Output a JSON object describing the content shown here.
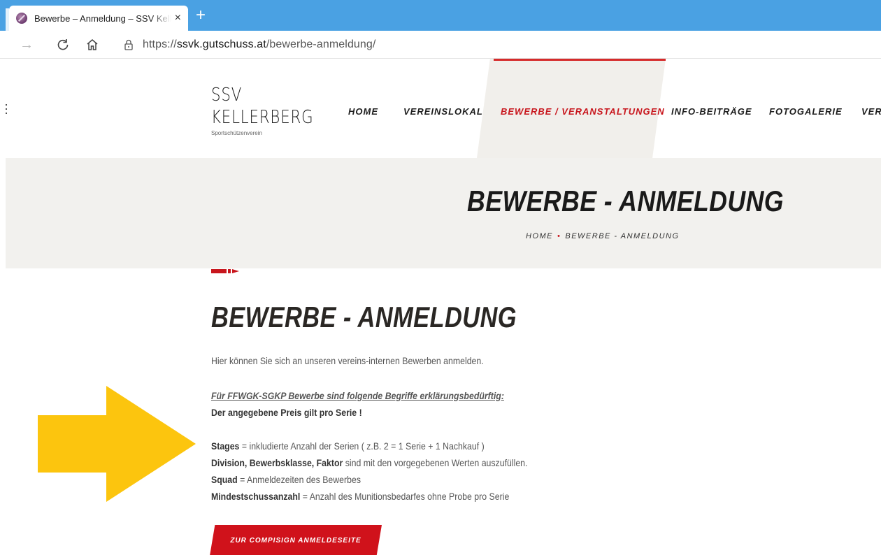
{
  "browser": {
    "tab_title": "Bewerbe – Anmeldung – SSV Kellerberg",
    "tab_close": "×",
    "new_tab": "+",
    "url_prefix": "https://",
    "url_host": "ssvk.gutschuss.at",
    "url_path": "/bewerbe-anmeldung/",
    "accent_color": "#4aa1e3"
  },
  "header": {
    "logo_line1": "SSV",
    "logo_line2": "KELLERBERG",
    "logo_sub": "Sportschützenverein",
    "menu_icon": "kebab-icon",
    "nav": [
      {
        "label": "HOME"
      },
      {
        "label": "VEREINSLOKAL"
      },
      {
        "label": "BEWERBE / VERANSTALTUNGEN",
        "active": true
      },
      {
        "label": "INFO-BEITRÄGE"
      },
      {
        "label": "FOTOGALERIE"
      },
      {
        "label": "VERE"
      }
    ],
    "active_color": "#c8161d"
  },
  "banner": {
    "title": "BEWERBE - ANMELDUNG",
    "breadcrumb_home": "HOME",
    "breadcrumb_sep": "•",
    "breadcrumb_current": "BEWERBE - ANMELDUNG"
  },
  "content": {
    "title": "BEWERBE - ANMELDUNG",
    "intro": "Hier können Sie sich an unseren vereins-internen Bewerben anmelden.",
    "subhead": "Für FFWGK-SGKP Bewerbe sind folgende Begriffe erklärungsbedürftig:",
    "price_note": "Der angegebene Preis gilt pro Serie !",
    "defs": [
      {
        "term": "Stages",
        "text": " = inkludierte Anzahl der Serien ( z.B. 2 = 1 Serie + 1 Nachkauf )"
      },
      {
        "term": "Division, Bewerbsklasse, Faktor",
        "text": " sind mit den vorgegebenen Werten auszufüllen."
      },
      {
        "term": "Squad",
        "text": " = Anmeldezeiten des Bewerbes"
      },
      {
        "term": "Mindestschussanzahl",
        "text": " = Anzahl des Munitionsbedarfes ohne Probe pro Serie"
      }
    ],
    "cta_label": "ZUR COMPISIGN ANMELDESEITE",
    "cta_color": "#d0121b",
    "arrow_color": "#fcc50e"
  }
}
